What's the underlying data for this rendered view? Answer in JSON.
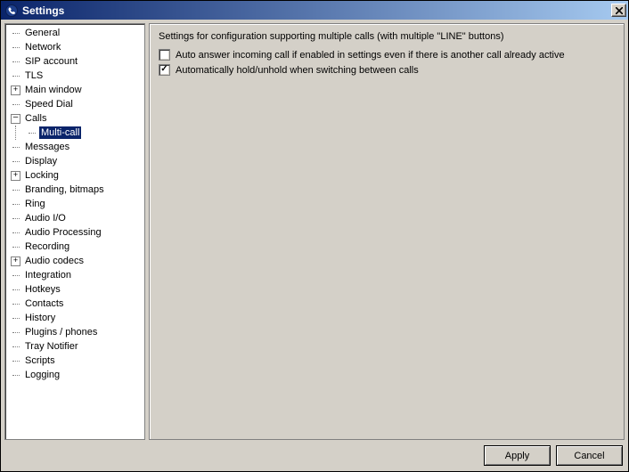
{
  "window": {
    "title": "Settings",
    "close_glyph": "✕"
  },
  "tree": {
    "items": [
      {
        "label": "General",
        "depth": 0,
        "box": "dash",
        "selected": false
      },
      {
        "label": "Network",
        "depth": 0,
        "box": "dash",
        "selected": false
      },
      {
        "label": "SIP account",
        "depth": 0,
        "box": "dash",
        "selected": false
      },
      {
        "label": "TLS",
        "depth": 0,
        "box": "dash",
        "selected": false
      },
      {
        "label": "Main window",
        "depth": 0,
        "box": "plus",
        "selected": false
      },
      {
        "label": "Speed Dial",
        "depth": 0,
        "box": "dash",
        "selected": false
      },
      {
        "label": "Calls",
        "depth": 0,
        "box": "minus",
        "selected": false
      },
      {
        "label": "Multi-call",
        "depth": 1,
        "box": "dash",
        "selected": true
      },
      {
        "label": "Messages",
        "depth": 0,
        "box": "dash",
        "selected": false
      },
      {
        "label": "Display",
        "depth": 0,
        "box": "dash",
        "selected": false
      },
      {
        "label": "Locking",
        "depth": 0,
        "box": "plus",
        "selected": false
      },
      {
        "label": "Branding, bitmaps",
        "depth": 0,
        "box": "dash",
        "selected": false
      },
      {
        "label": "Ring",
        "depth": 0,
        "box": "dash",
        "selected": false
      },
      {
        "label": "Audio I/O",
        "depth": 0,
        "box": "dash",
        "selected": false
      },
      {
        "label": "Audio Processing",
        "depth": 0,
        "box": "dash",
        "selected": false
      },
      {
        "label": "Recording",
        "depth": 0,
        "box": "dash",
        "selected": false
      },
      {
        "label": "Audio codecs",
        "depth": 0,
        "box": "plus",
        "selected": false
      },
      {
        "label": "Integration",
        "depth": 0,
        "box": "dash",
        "selected": false
      },
      {
        "label": "Hotkeys",
        "depth": 0,
        "box": "dash",
        "selected": false
      },
      {
        "label": "Contacts",
        "depth": 0,
        "box": "dash",
        "selected": false
      },
      {
        "label": "History",
        "depth": 0,
        "box": "dash",
        "selected": false
      },
      {
        "label": "Plugins / phones",
        "depth": 0,
        "box": "dash",
        "selected": false
      },
      {
        "label": "Tray Notifier",
        "depth": 0,
        "box": "dash",
        "selected": false
      },
      {
        "label": "Scripts",
        "depth": 0,
        "box": "dash",
        "selected": false
      },
      {
        "label": "Logging",
        "depth": 0,
        "box": "dash",
        "selected": false
      }
    ]
  },
  "content": {
    "subtitle": "Settings for configuration supporting multiple calls (with multiple \"LINE\" buttons)",
    "options": [
      {
        "checked": false,
        "label": "Auto answer incoming call if enabled in settings even if there is another call already active"
      },
      {
        "checked": true,
        "label": "Automatically hold/unhold when switching between calls"
      }
    ]
  },
  "buttons": {
    "apply": "Apply",
    "cancel": "Cancel"
  }
}
